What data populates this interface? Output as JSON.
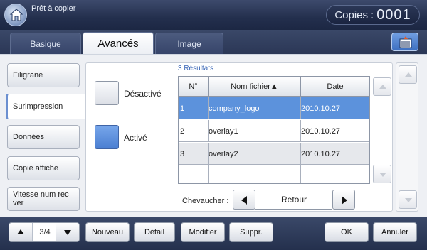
{
  "header": {
    "status": "Prêt à copier",
    "copies_label": "Copies",
    "copies_colon": ":",
    "copies_count": "0001",
    "home_icon": "home-icon"
  },
  "tabs": [
    {
      "label": "Basique",
      "active": false
    },
    {
      "label": "Avancés",
      "active": true
    },
    {
      "label": "Image",
      "active": false
    }
  ],
  "settings_icon": "job-settings-icon",
  "sidebar": {
    "items": [
      {
        "label": "Filigrane"
      },
      {
        "label": "Surimpression",
        "selected": true
      },
      {
        "label": "Données"
      },
      {
        "label": "Copie affiche"
      },
      {
        "label": "Vitesse num rec ver"
      }
    ]
  },
  "options": {
    "off_label": "Désactivé",
    "on_label": "Activé",
    "selected": "on"
  },
  "results": {
    "count_label": "3 Résultats",
    "columns": [
      "N°",
      "Nom fichier▲",
      "Date"
    ],
    "rows": [
      {
        "num": "1",
        "name": "company_logo",
        "date": "2010.10.27",
        "selected": true
      },
      {
        "num": "2",
        "name": "overlay1",
        "date": "2010.10.27"
      },
      {
        "num": "3",
        "name": "overlay2",
        "date": "2010.10.27"
      },
      {
        "num": "",
        "name": "",
        "date": ""
      }
    ]
  },
  "overlap": {
    "label": "Chevaucher :",
    "value": "Retour"
  },
  "pager": {
    "text": "3/4"
  },
  "bottom_buttons": {
    "new": "Nouveau",
    "detail": "Détail",
    "modify": "Modifier",
    "delete": "Suppr.",
    "ok": "OK",
    "cancel": "Annuler"
  },
  "colors": {
    "accent": "#5c92dc",
    "header_bg": "#232f4d",
    "results_text": "#3c68b8"
  }
}
